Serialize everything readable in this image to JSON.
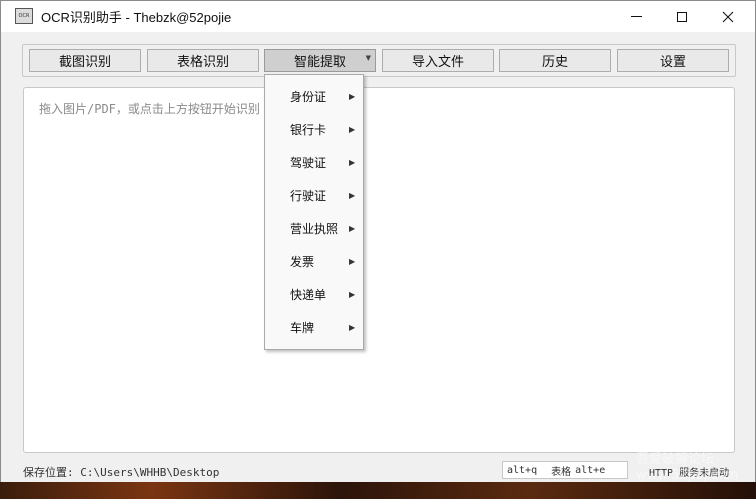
{
  "window": {
    "title": "OCR识别助手 - Thebzk@52pojie",
    "app_icon_text": "OCR"
  },
  "toolbar": {
    "buttons": [
      {
        "label": "截图识别"
      },
      {
        "label": "表格识别"
      },
      {
        "label": "智能提取",
        "active": true,
        "has_dropdown": true
      },
      {
        "label": "导入文件"
      },
      {
        "label": "历史"
      },
      {
        "label": "设置"
      }
    ]
  },
  "main": {
    "placeholder": "拖入图片/PDF，或点击上方按钮开始识别"
  },
  "dropdown_menu": {
    "items": [
      {
        "label": "身份证"
      },
      {
        "label": "银行卡"
      },
      {
        "label": "驾驶证"
      },
      {
        "label": "行驶证"
      },
      {
        "label": "营业执照"
      },
      {
        "label": "发票"
      },
      {
        "label": "快递单"
      },
      {
        "label": "车牌"
      }
    ]
  },
  "statusbar": {
    "save_location_label": "保存位置:",
    "save_path": "C:\\Users\\WHHB\\Desktop",
    "hotkey_screenshot": "alt+q",
    "hotkey_table_label": "表格",
    "hotkey_table": "alt+e",
    "http_label": "HTTP 服务未启动"
  },
  "watermark": {
    "line1": "吾爱破解论坛",
    "line2": "www.52pojie.cn"
  },
  "colors": {
    "window_bg": "#f0f0f0",
    "active_button": "#cfcfcf",
    "menu_bg": "#f9f9f9"
  }
}
